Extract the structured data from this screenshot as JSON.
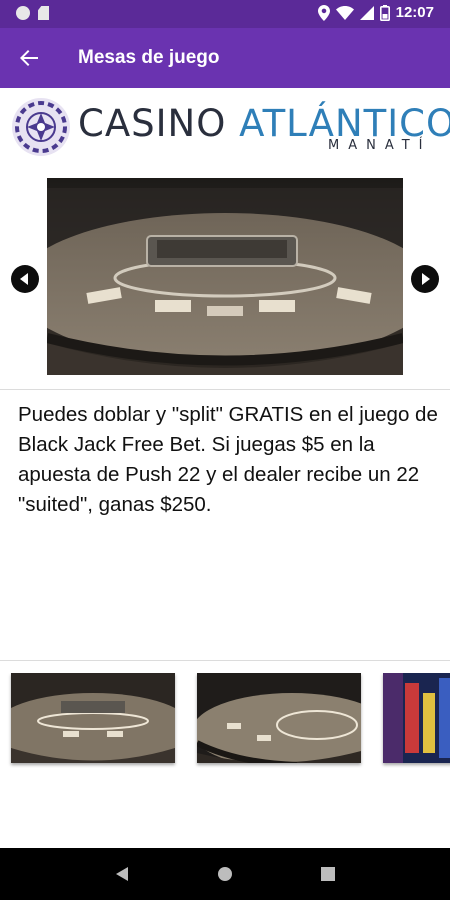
{
  "status_bar": {
    "time": "12:07",
    "icons": [
      "notification-dot-icon",
      "sd-card-icon",
      "location-icon",
      "wifi-icon",
      "signal-icon",
      "battery-icon"
    ]
  },
  "app_bar": {
    "title": "Mesas de juego",
    "back_icon": "arrow-back-icon",
    "background": "#6a33b0"
  },
  "logo": {
    "word1": "CASINO",
    "word2": "ATLÁNTICO",
    "subtitle": "MANATÍ",
    "colors": {
      "dark": "#2a2f3d",
      "accent": "#2f7fb8",
      "emblem": "#4a3a8f"
    }
  },
  "carousel": {
    "image_alt": "Black Jack table",
    "prev_icon": "chevron-left-icon",
    "next_icon": "chevron-right-icon"
  },
  "description": "Puedes doblar y \"split\" GRATIS en el juego de Black Jack Free Bet. Si juegas $5 en la apuesta de Push 22 y el dealer recibe un 22 \"suited\", ganas $250.",
  "thumbnails": [
    {
      "alt": "Black Jack table thumbnail 1"
    },
    {
      "alt": "Black Jack table thumbnail 2"
    },
    {
      "alt": "Casino thumbnail 3"
    }
  ],
  "nav_bar": {
    "buttons": [
      "back-triangle-icon",
      "home-circle-icon",
      "recents-square-icon"
    ]
  }
}
